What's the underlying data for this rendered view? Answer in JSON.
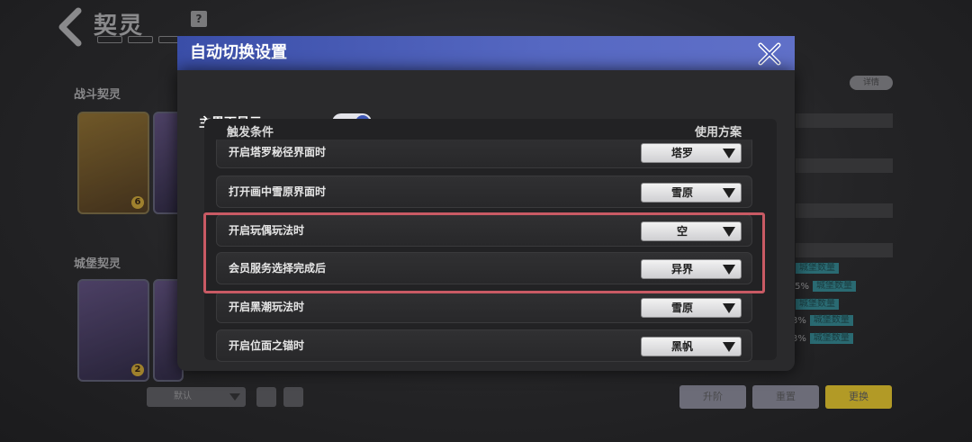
{
  "background": {
    "title": "契灵",
    "help_icon": "?",
    "section_battle": "战斗契灵",
    "section_guard": "城堡契灵",
    "detail_pill": "详情",
    "card_badges": [
      "6",
      "2"
    ],
    "select_label": "默认",
    "stat_labels": [
      "城堡数量",
      "城堡数量",
      "城堡数量",
      "城堡数量",
      "城堡数量"
    ],
    "stat_values": [
      "",
      ".5%",
      "",
      "3%",
      "3%"
    ],
    "button_left": "升阶",
    "button_mid": "重置",
    "button_right": "更换"
  },
  "dialog": {
    "title": "自动切换设置",
    "main_display_label": "主界面显示",
    "main_display_on": true,
    "col_trigger": "触发条件",
    "col_scheme": "使用方案",
    "rows": [
      {
        "condition": "开启塔罗秘径界面时",
        "scheme": "塔罗"
      },
      {
        "condition": "打开画中雪原界面时",
        "scheme": "雪原"
      },
      {
        "condition": "开启玩偶玩法时",
        "scheme": "空"
      },
      {
        "condition": "会员服务选择完成后",
        "scheme": "异界"
      },
      {
        "condition": "开启黑潮玩法时",
        "scheme": "雪原"
      },
      {
        "condition": "开启位面之锚时",
        "scheme": "黑帆"
      }
    ]
  },
  "colors": {
    "header_blue": "#4a5cba",
    "toggle_knob": "#3d55b4",
    "highlight": "#c95a64"
  },
  "icons": {
    "back": "back-arrow-icon",
    "close": "close-x-icon",
    "dropdown": "dropdown-triangle-icon"
  }
}
